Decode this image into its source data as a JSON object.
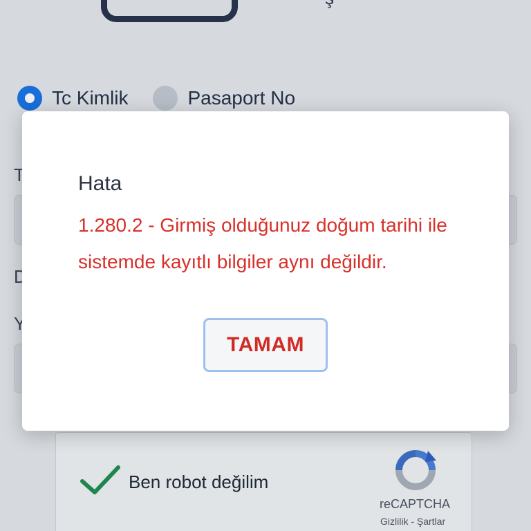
{
  "background": {
    "id_type": {
      "options": [
        {
          "label": "Tc Kimlik",
          "selected": true
        },
        {
          "label": "Pasaport No",
          "selected": false
        }
      ]
    },
    "fields": [
      {
        "label_fragment": "T"
      },
      {
        "label_fragment": "D"
      },
      {
        "label_fragment": "Y"
      }
    ],
    "captcha": {
      "label": "Ben robot değilim",
      "checked": true,
      "brand": "reCAPTCHA",
      "terms": "Gizlilik - Şartlar"
    }
  },
  "dialog": {
    "title": "Hata",
    "message": "1.280.2 - Girmiş olduğunuz doğum tarihi ile sistemde kayıtlı bilgiler aynı değildir.",
    "ok_label": "TAMAM"
  },
  "colors": {
    "accent": "#1773e8",
    "error": "#d9302a",
    "button_text": "#d12b25",
    "button_border": "#9cc2ec",
    "check": "#1e8e4e"
  },
  "icons": {
    "logo": "app-logo-icon",
    "check": "checkmark-icon",
    "recaptcha": "recaptcha-icon"
  }
}
